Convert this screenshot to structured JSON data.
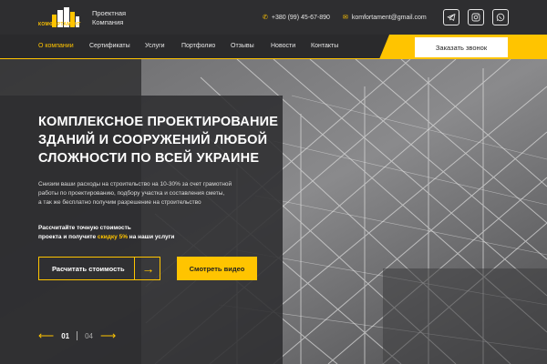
{
  "brand": {
    "logo_text": "КОМФОРТАМЕНТ",
    "company_line1": "Проектная",
    "company_line2": "Компания",
    "accent": "#ffc400"
  },
  "contacts": {
    "phone": "+380 (99) 45-67-890",
    "email": "komfortament@gmail.com",
    "phone_icon": "phone-icon",
    "email_icon": "mail-icon"
  },
  "social": [
    {
      "name": "telegram-icon"
    },
    {
      "name": "instagram-icon"
    },
    {
      "name": "whatsapp-icon"
    }
  ],
  "nav": {
    "items": [
      "О компании",
      "Сертификаты",
      "Услуги",
      "Портфолио",
      "Отзывы",
      "Новости",
      "Контакты"
    ],
    "active": "О компании",
    "call_button": "Заказать звонок"
  },
  "hero": {
    "title_line1": "КОМПЛЕКСНОЕ ПРОЕКТИРОВАНИЕ",
    "title_line2": "ЗДАНИЙ И СООРУЖЕНИЙ ЛЮБОЙ",
    "title_line3": "СЛОЖНОСТИ ПО ВСЕЙ УКРАИНЕ",
    "desc_line1": "Снизим ваши расходы на строительство на 10-30% за счет грамотной",
    "desc_line2": "работы по проектированию, подбору участка и составления сметы,",
    "desc_line3": "а так же бесплатно получим разрешение на строительство",
    "promo_line1": "Рассчитайте точную стоимость",
    "promo_pre": "проекта и получите ",
    "promo_highlight": "скидку 5%",
    "promo_post": " на наши услуги",
    "calc_button": "Расчитать стоимость",
    "video_button": "Смотреть видео"
  },
  "slider": {
    "current": "01",
    "total": "04"
  }
}
